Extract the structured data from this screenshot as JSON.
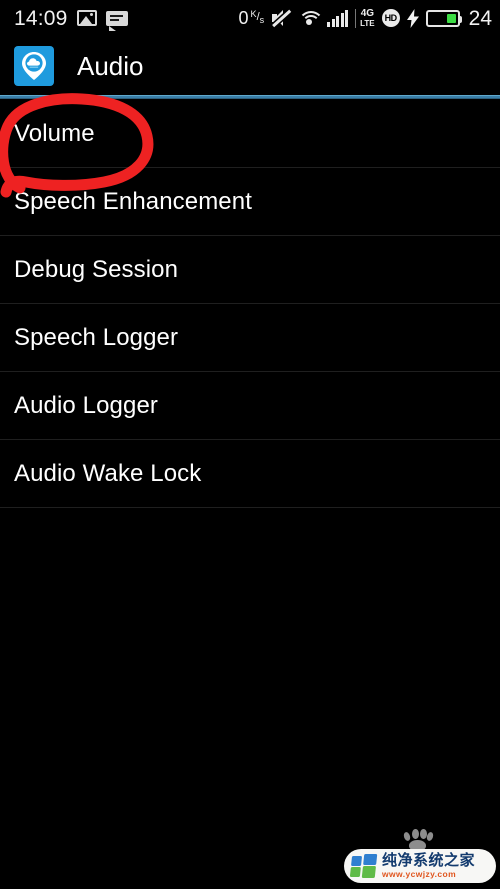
{
  "status_bar": {
    "clock": "14:09",
    "network_speed_value": "0",
    "network_speed_unit_num": "K",
    "network_speed_unit_den": "s",
    "network_type_line1": "4G",
    "network_type_line2": "LTE",
    "volte_label": "HD",
    "battery_percent": "24",
    "icons": [
      "photo-icon",
      "message-icon",
      "network-speed-icon",
      "mute-icon",
      "wifi-icon",
      "signal-bars-icon",
      "4g-lte-icon",
      "hd-volte-icon",
      "charging-bolt-icon",
      "battery-icon"
    ]
  },
  "action_bar": {
    "app_icon_name": "cloud-pin-icon",
    "title": "Audio",
    "accent_color": "#3a7fa8",
    "app_icon_color": "#1f9bde"
  },
  "list": {
    "items": [
      {
        "label": "Volume",
        "annotated": true
      },
      {
        "label": "Speech Enhancement",
        "annotated": false
      },
      {
        "label": "Debug Session",
        "annotated": false
      },
      {
        "label": "Speech Logger",
        "annotated": false
      },
      {
        "label": "Audio Logger",
        "annotated": false
      },
      {
        "label": "Audio Wake Lock",
        "annotated": false
      }
    ]
  },
  "annotation": {
    "name": "red-circle-highlight",
    "target": "Volume",
    "color": "#ee2222"
  },
  "watermark": {
    "site_name": "纯净系统之家",
    "url": "www.ycwjzy.com",
    "paw_icon": "paw-print-icon",
    "brand_colors": {
      "blue": "#2f7fd0",
      "green": "#5fbb47",
      "text": "#123a6e",
      "url": "#e0561f"
    }
  }
}
